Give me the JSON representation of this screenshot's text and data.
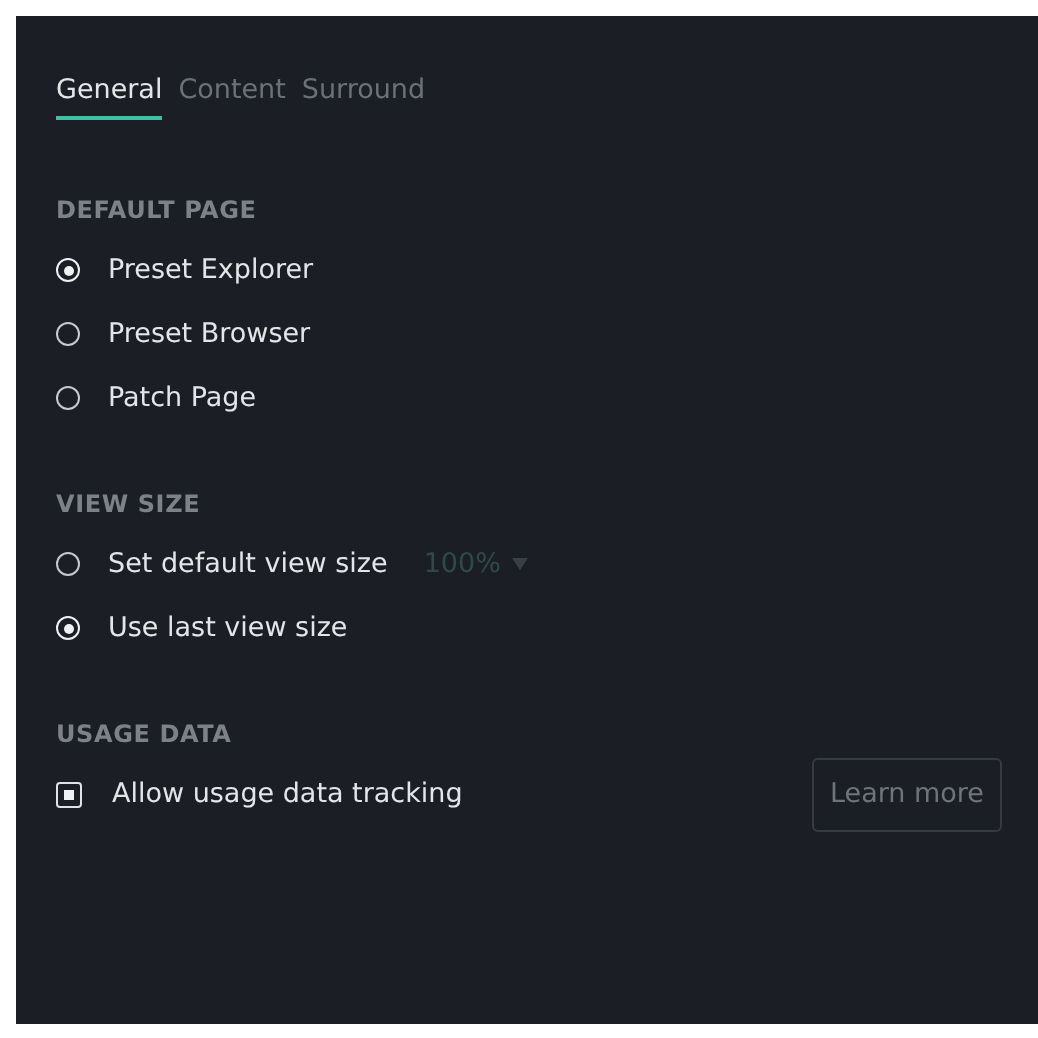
{
  "tabs": [
    {
      "label": "General",
      "selected": true
    },
    {
      "label": "Content",
      "selected": false
    },
    {
      "label": "Surround",
      "selected": false
    }
  ],
  "sections": [
    {
      "title": "DEFAULT PAGE",
      "items": [
        {
          "kind": "radio",
          "label": "Preset Explorer",
          "selected": true
        },
        {
          "kind": "radio",
          "label": "Preset Browser",
          "selected": false
        },
        {
          "kind": "radio",
          "label": "Patch Page",
          "selected": false
        }
      ]
    },
    {
      "title": "VIEW SIZE",
      "items": [
        {
          "kind": "radio",
          "label": "Set default view size",
          "selected": false,
          "dropdown": {
            "value": "100%",
            "disabled": true
          }
        },
        {
          "kind": "radio",
          "label": "Use last view size",
          "selected": true
        }
      ]
    },
    {
      "title": "USAGE DATA",
      "items": [
        {
          "kind": "checkbox",
          "label": "Allow usage data tracking",
          "checked": true,
          "button": "Learn more"
        }
      ]
    }
  ]
}
